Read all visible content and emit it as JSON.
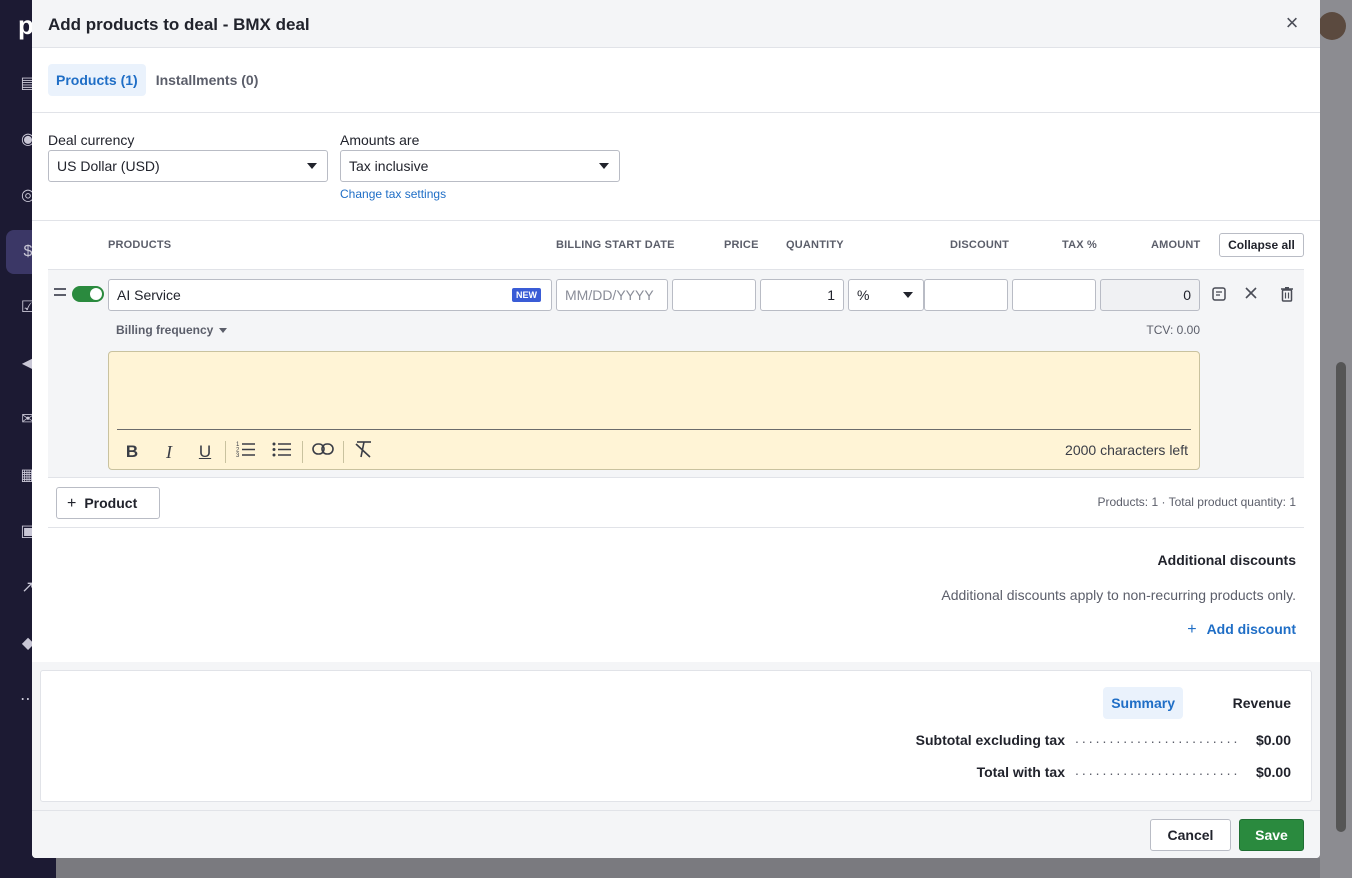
{
  "modal": {
    "title": "Add products to deal - BMX deal",
    "close_icon": "×"
  },
  "tabs": [
    {
      "label": "Products (1)",
      "active": true
    },
    {
      "label": "Installments (0)",
      "active": false
    }
  ],
  "settings": {
    "currency_label": "Deal currency",
    "currency_value": "US Dollar (USD)",
    "amounts_label": "Amounts are",
    "amounts_value": "Tax inclusive",
    "change_tax_link": "Change tax settings"
  },
  "table": {
    "headers": {
      "products": "PRODUCTS",
      "billing_start": "BILLING START DATE",
      "price": "PRICE",
      "quantity": "QUANTITY",
      "discount": "DISCOUNT",
      "tax": "TAX %",
      "amount": "AMOUNT"
    },
    "collapse_all": "Collapse all"
  },
  "product": {
    "enabled": true,
    "name": "AI Service",
    "badge": "NEW",
    "billing_start_placeholder": "MM/DD/YYYY",
    "price": "",
    "quantity": "1",
    "discount_type": "%",
    "discount": "",
    "tax": "",
    "amount": "0",
    "billing_frequency_label": "Billing frequency",
    "tcv": "TCV: 0.00",
    "note": "",
    "chars_left": "2000 characters left",
    "icons": [
      "note-icon",
      "remove-item-icon",
      "trash-icon"
    ]
  },
  "editor_toolbar": [
    "bold-icon",
    "italic-icon",
    "underline-icon",
    "ordered-list-icon",
    "bullet-list-icon",
    "link-icon",
    "clear-format-icon"
  ],
  "add_product_label": "Product",
  "product_stats": "Products: 1 · Total product quantity: 1",
  "discounts": {
    "title": "Additional discounts",
    "note": "Additional discounts apply to non-recurring products only.",
    "add_link": "Add discount"
  },
  "summary": {
    "tabs": [
      {
        "label": "Summary",
        "active": true
      },
      {
        "label": "Revenue",
        "active": false
      }
    ],
    "rows": [
      {
        "label": "Subtotal excluding tax",
        "value": "$0.00"
      },
      {
        "label": "Total with tax",
        "value": "$0.00"
      }
    ]
  },
  "footer": {
    "cancel": "Cancel",
    "save": "Save"
  },
  "colors": {
    "accent": "#1f6ec6",
    "save": "#2a8a3e",
    "note_bg": "#fff4d6",
    "badge": "#3a5cd6"
  }
}
